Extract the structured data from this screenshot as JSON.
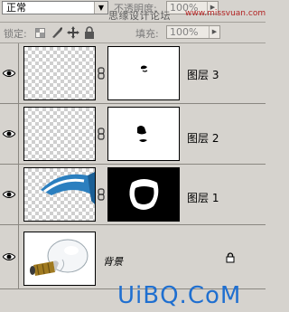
{
  "toolbar": {
    "blend_mode": "正常",
    "opacity_label": "不透明度:",
    "opacity_value": "100%",
    "lock_label": "锁定:",
    "fill_label": "填充:",
    "fill_value": "100%"
  },
  "watermark": {
    "site_name": "思缘设计论坛",
    "site_url": "www.missvuan.com",
    "footer": "UiBQ.CoM"
  },
  "layers": [
    {
      "name": "图层 3"
    },
    {
      "name": "图层 2"
    },
    {
      "name": "图层 1"
    },
    {
      "name": "背景"
    }
  ],
  "colors": {
    "panel_bg": "#d6d3ce",
    "footer_text": "#1f6fd0"
  }
}
